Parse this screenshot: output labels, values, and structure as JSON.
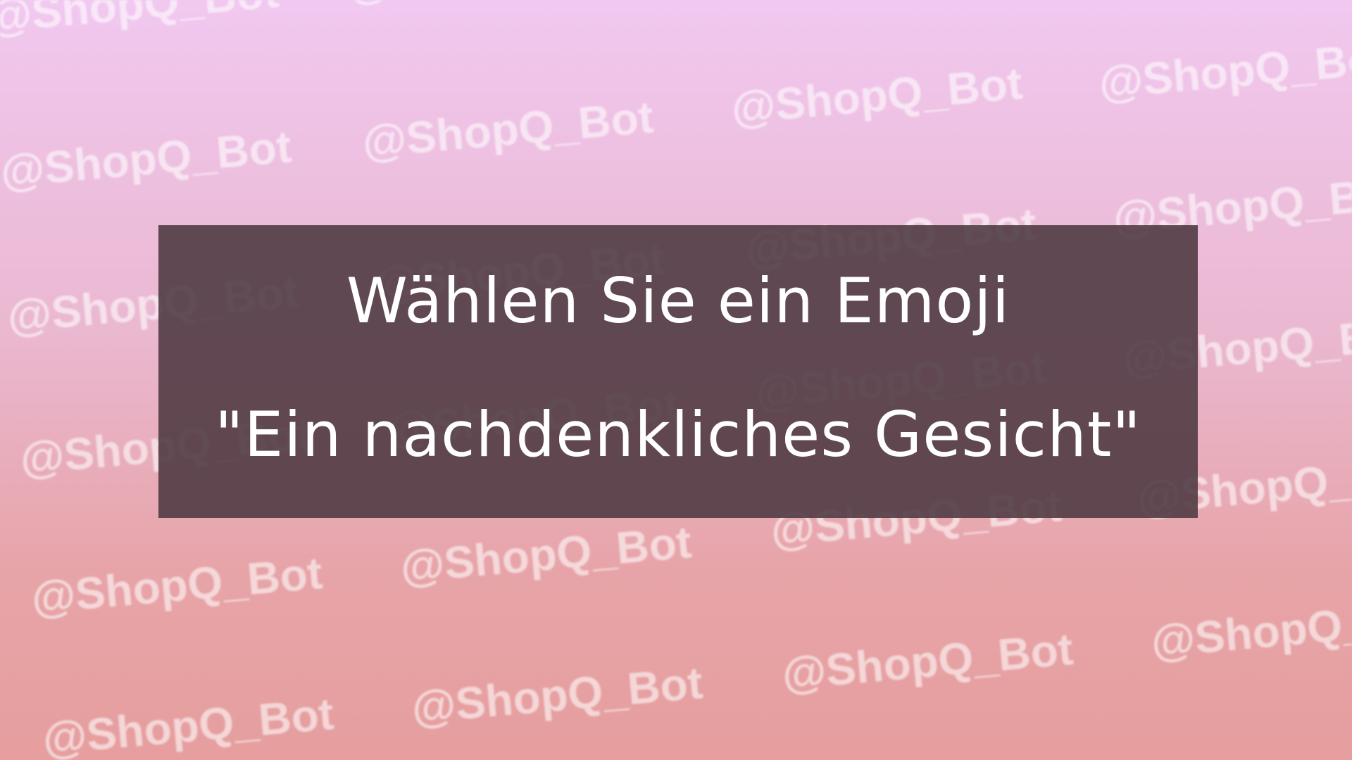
{
  "background": {
    "gradient_top": "#f1c8f0",
    "gradient_bottom": "#e69e9e",
    "watermark_text": "@ShopQ_Bot"
  },
  "prompt": {
    "line1": "Wählen Sie ein Emoji",
    "line2": "\"Ein nachdenkliches Gesicht\""
  }
}
